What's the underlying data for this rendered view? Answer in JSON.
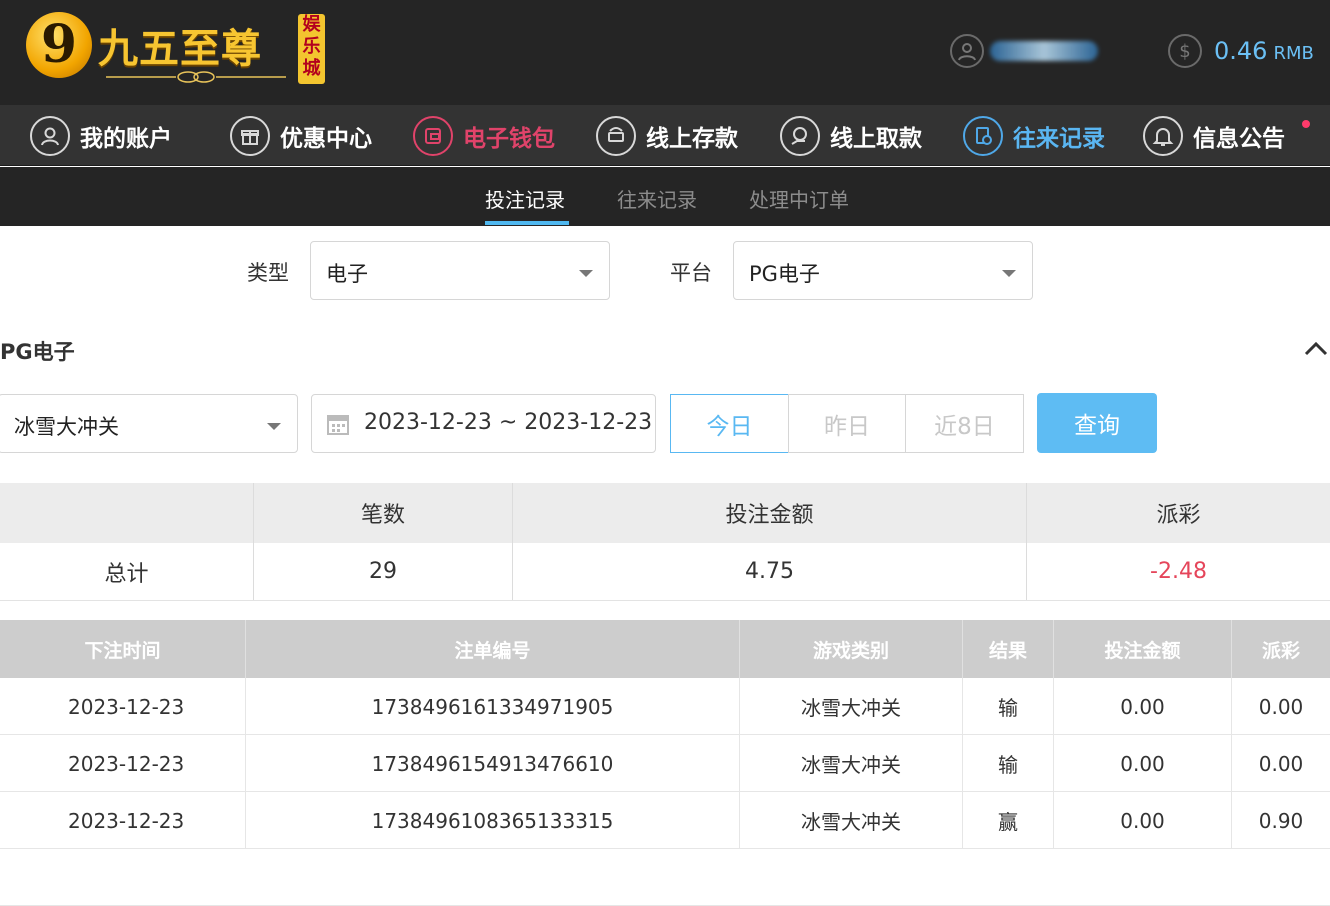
{
  "brand": {
    "logo_numeral": "9",
    "logo_text": "九五至尊",
    "badge_chars": [
      "娱",
      "乐",
      "城"
    ]
  },
  "account": {
    "username": "",
    "balance": "0.46",
    "currency": "RMB"
  },
  "nav": {
    "items": [
      {
        "label": "我的账户",
        "icon": "user-icon"
      },
      {
        "label": "优惠中心",
        "icon": "gift-icon"
      },
      {
        "label": "电子钱包",
        "icon": "wallet-icon"
      },
      {
        "label": "线上存款",
        "icon": "deposit-icon"
      },
      {
        "label": "线上取款",
        "icon": "withdraw-icon"
      },
      {
        "label": "往来记录",
        "icon": "records-icon"
      },
      {
        "label": "信息公告",
        "icon": "bell-icon"
      }
    ],
    "active_colors": {
      "wallet": "#e0436a",
      "records": "#5ab6f2"
    }
  },
  "subtabs": {
    "bets": "投注记录",
    "transactions": "往来记录",
    "pending": "处理中订单"
  },
  "filters": {
    "type_label": "类型",
    "type_value": "电子",
    "platform_label": "平台",
    "platform_value": "PG电子"
  },
  "section": {
    "title": "PG电子"
  },
  "query": {
    "game_value": "冰雪大冲关",
    "date_range": "2023-12-23 ~ 2023-12-23",
    "today": "今日",
    "yesterday": "昨日",
    "last8": "近8日",
    "submit": "查询"
  },
  "summary": {
    "headers": {
      "count": "笔数",
      "bet_amount": "投注金额",
      "payout": "派彩"
    },
    "total_label": "总计",
    "count": "29",
    "bet_amount": "4.75",
    "payout": "-2.48"
  },
  "details": {
    "headers": {
      "time": "下注时间",
      "order_no": "注单编号",
      "game": "游戏类别",
      "result": "结果",
      "bet": "投注金额",
      "payout": "派彩"
    },
    "rows": [
      {
        "time": "2023-12-23",
        "order_no": "1738496161334971905",
        "game": "冰雪大冲关",
        "result": "输",
        "bet": "0.00",
        "payout": "0.00"
      },
      {
        "time": "2023-12-23",
        "order_no": "1738496154913476610",
        "game": "冰雪大冲关",
        "result": "输",
        "bet": "0.00",
        "payout": "0.00"
      },
      {
        "time": "2023-12-23",
        "order_no": "1738496108365133315",
        "game": "冰雪大冲关",
        "result": "赢",
        "bet": "0.00",
        "payout": "0.90"
      }
    ]
  }
}
